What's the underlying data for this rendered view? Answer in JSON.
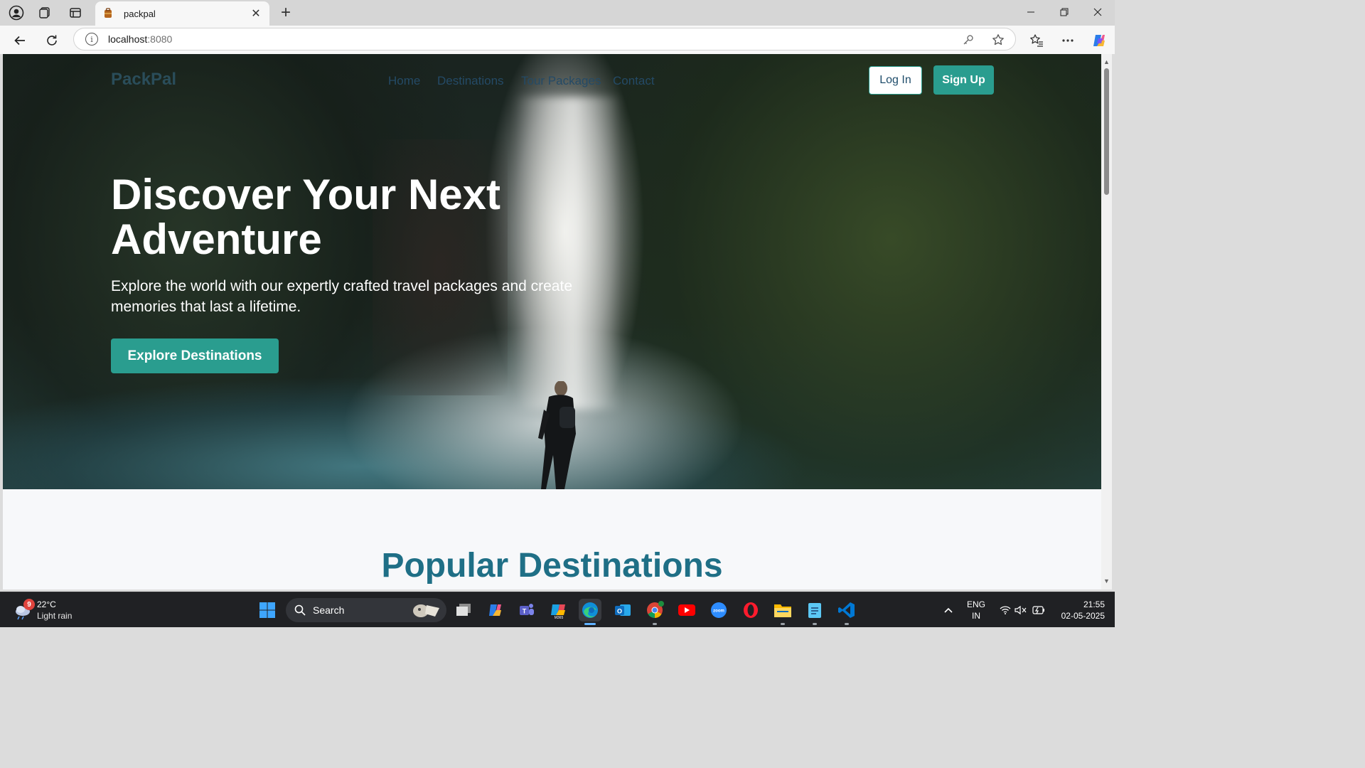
{
  "browser": {
    "tab_title": "packpal",
    "url_host": "localhost",
    "url_port": ":8080"
  },
  "site": {
    "logo": "PackPal",
    "nav": [
      "Home",
      "Destinations",
      "Tour Packages",
      "Contact"
    ],
    "login_label": "Log In",
    "signup_label": "Sign Up",
    "hero_title": "Discover Your Next Adventure",
    "hero_subtitle": "Explore the world with our expertly crafted travel packages and create memories that last a lifetime.",
    "hero_cta": "Explore Destinations",
    "section_title": "Popular Destinations"
  },
  "taskbar": {
    "weather_badge": "9",
    "temperature": "22°C",
    "weather_desc": "Light rain",
    "search_label": "Search",
    "lang_top": "ENG",
    "lang_bottom": "IN",
    "time": "21:55",
    "date": "02-05-2025"
  },
  "colors": {
    "accent": "#2a9d8f",
    "nav_text": "#244a66",
    "section_title": "#1f6f86",
    "taskbar": "#202124"
  },
  "icons": {
    "tabbar": [
      "profile-icon",
      "collections-icon",
      "sidebar-icon"
    ],
    "addressbar": [
      "back-icon",
      "refresh-icon",
      "info-icon",
      "key-icon",
      "star-icon",
      "favorites-icon",
      "more-icon",
      "copilot-icon"
    ],
    "taskbar_apps": [
      "task-view-icon",
      "copilot-app-icon",
      "teams-icon",
      "m365-icon",
      "edge-icon",
      "outlook-icon",
      "chrome-icon",
      "youtube-icon",
      "zoom-icon",
      "opera-icon",
      "file-explorer-icon",
      "notepad-icon",
      "vscode-icon"
    ]
  }
}
